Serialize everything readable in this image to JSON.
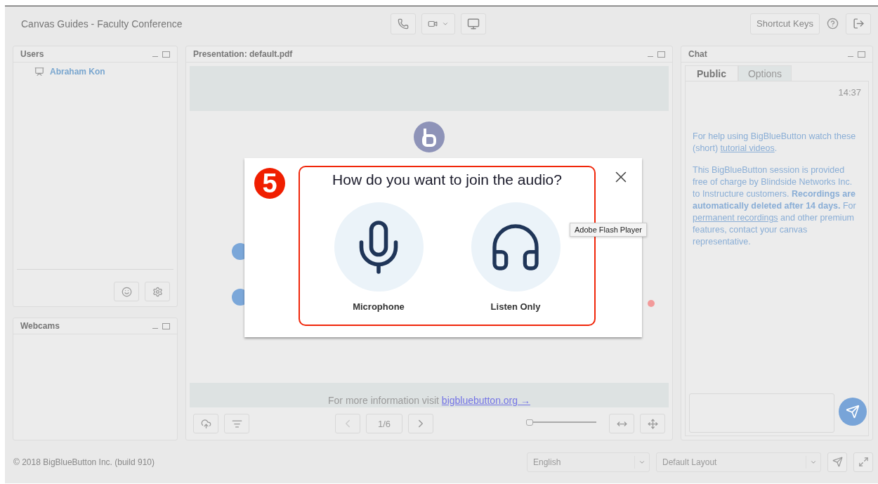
{
  "header": {
    "title": "Canvas Guides - Faculty  Conference",
    "shortcut_keys": "Shortcut Keys"
  },
  "users_panel": {
    "title": "Users",
    "users": [
      {
        "name": "Abraham Kon"
      }
    ]
  },
  "webcams_panel": {
    "title": "Webcams"
  },
  "presentation": {
    "title": "Presentation: default.pdf",
    "info_text": "For more information visit ",
    "info_link": "bigbluebutton.org →",
    "page": "1/6",
    "zoom_slider": {
      "level": 0
    }
  },
  "chat": {
    "title": "Chat",
    "tabs": [
      {
        "label": "Public",
        "selected": true
      },
      {
        "label": "Options",
        "selected": false
      }
    ],
    "time": "14:37",
    "messages": [
      [
        {
          "kind": "text",
          "text": "For help using BigBlueButton watch these (short) "
        },
        {
          "kind": "link",
          "text": "tutorial videos"
        },
        {
          "kind": "text",
          "text": "."
        }
      ],
      [
        {
          "kind": "text",
          "text": "This BigBlueButton session is provided free of charge by Blindside Networks Inc. to Instructure customers. "
        },
        {
          "kind": "bold",
          "text": "Recordings are automatically deleted after 14 days."
        },
        {
          "kind": "text",
          "text": "  For "
        },
        {
          "kind": "link",
          "text": "permanent recordings"
        },
        {
          "kind": "text",
          "text": " and other premium features, contact your canvas representative."
        }
      ]
    ]
  },
  "footer": {
    "copyright": "© 2018 BigBlueButton Inc. (build 910)",
    "language": "English",
    "layout": "Default Layout"
  },
  "dialog": {
    "step": "5",
    "title": "How do you want to join the audio?",
    "options": [
      {
        "kind": "microphone",
        "label": "Microphone"
      },
      {
        "kind": "listen",
        "label": "Listen Only"
      }
    ]
  },
  "tooltip": "Adobe Flash Player"
}
